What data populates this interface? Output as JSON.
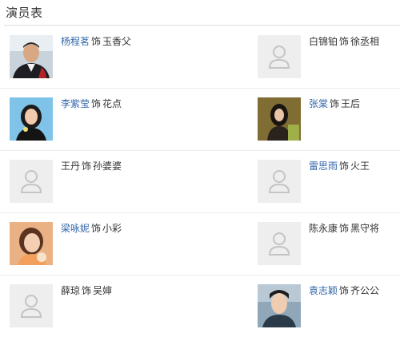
{
  "section": {
    "title": "演员表"
  },
  "colors": {
    "link": "#3366aa",
    "text": "#333333",
    "placeholder_bg": "#eeeeee",
    "divider": "#ececec"
  },
  "cast": [
    {
      "left": {
        "actor": "杨程茗",
        "linked": true,
        "role_word": "饰",
        "role": "玉香父",
        "photo": "man-photo"
      },
      "right": {
        "actor": "白锦铂",
        "linked": false,
        "role_word": "饰",
        "role": "徐丞相",
        "photo": "placeholder"
      }
    },
    {
      "left": {
        "actor": "李紫莹",
        "linked": true,
        "role_word": "饰",
        "role": "花点",
        "photo": "woman-photo"
      },
      "right": {
        "actor": "张棠",
        "linked": true,
        "role_word": "饰",
        "role": "王后",
        "photo": "woman-photo"
      }
    },
    {
      "left": {
        "actor": "王丹",
        "linked": false,
        "role_word": "饰",
        "role": "孙婆婆",
        "photo": "placeholder"
      },
      "right": {
        "actor": "雷思雨",
        "linked": true,
        "role_word": "饰",
        "role": "火王",
        "photo": "placeholder"
      }
    },
    {
      "left": {
        "actor": "梁咏妮",
        "linked": true,
        "role_word": "饰",
        "role": "小彩",
        "photo": "woman-photo"
      },
      "right": {
        "actor": "陈永康",
        "linked": false,
        "role_word": "饰",
        "role": "黑守将",
        "photo": "placeholder"
      }
    },
    {
      "left": {
        "actor": "薛琼",
        "linked": false,
        "role_word": "饰",
        "role": "吴婶",
        "photo": "placeholder"
      },
      "right": {
        "actor": "袁志颖",
        "linked": true,
        "role_word": "饰",
        "role": "齐公公",
        "photo": "man-photo"
      }
    }
  ]
}
